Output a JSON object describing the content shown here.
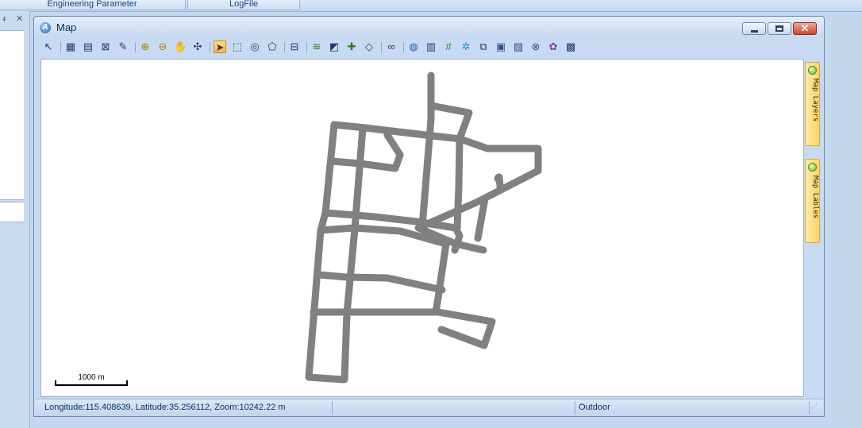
{
  "tabs": [
    {
      "label": "Engineering Parameter"
    },
    {
      "label": "LogFile"
    }
  ],
  "left_pane": {
    "pin_icon": "pin-icon",
    "close_icon": "close-icon",
    "pin_glyph": "ᵲ",
    "close_glyph": "✕"
  },
  "window": {
    "title": "Map",
    "app_icon": "app-logo-icon",
    "app_icon_glyph": "A",
    "close_glyph": "✕",
    "controls": [
      "minimize",
      "maximize",
      "close"
    ]
  },
  "toolbar": {
    "groups": [
      [
        "pointer-icon"
      ],
      [
        "map-grid-icon",
        "map-export-icon",
        "map-compass-icon",
        "map-edit-icon"
      ],
      [
        "zoom-in-icon",
        "zoom-out-icon",
        "pan-hand-icon",
        "full-extent-icon"
      ],
      [
        "select-arrow-icon",
        "select-rect-icon",
        "select-circle-icon",
        "select-polygon-icon"
      ],
      [
        "measure-ruler-icon"
      ],
      [
        "layers-icon",
        "raster-layer-icon",
        "add-layer-icon",
        "polygon-layer-icon"
      ],
      [
        "binoculars-icon"
      ],
      [
        "globe-icon",
        "table-icon",
        "grid-hash-icon",
        "network-icon",
        "copy-icon",
        "cube-icon",
        "cube-settings-icon",
        "cube-remove-icon",
        "plugin-icon",
        "legend-icon"
      ]
    ],
    "active": "select-arrow-icon"
  },
  "map": {
    "track_color": "#808080",
    "scale_label": "1000 m"
  },
  "side_tabs": [
    {
      "label": "Map Layers"
    },
    {
      "label": "Map Lables"
    }
  ],
  "status": {
    "coords": "Longitude:115.408639, Latitude:35.256112, Zoom:10242.22 m",
    "middle": "",
    "mode": "Outdoor"
  }
}
